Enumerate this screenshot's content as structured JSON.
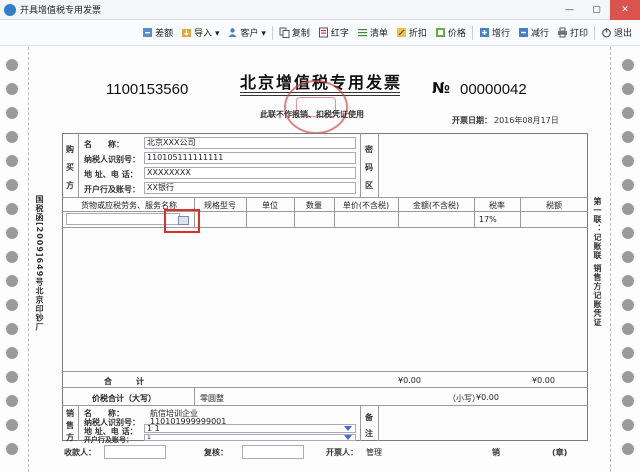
{
  "window": {
    "title": "开具增值税专用发票",
    "minimize": "—",
    "maximize": "▢",
    "close": "✕"
  },
  "toolbar": {
    "items": [
      {
        "label": "差额",
        "icon": "difference-icon"
      },
      {
        "label": "导入 ▾",
        "icon": "import-icon"
      },
      {
        "label": "客户 ▾",
        "icon": "customer-icon"
      },
      {
        "label": "复制",
        "icon": "copy-icon"
      },
      {
        "label": "红字",
        "icon": "red-invoice-icon"
      },
      {
        "label": "清单",
        "icon": "list-icon"
      },
      {
        "label": "折扣",
        "icon": "discount-icon"
      },
      {
        "label": "价格",
        "icon": "price-icon"
      },
      {
        "label": "增行",
        "icon": "add-row-icon"
      },
      {
        "label": "减行",
        "icon": "remove-row-icon"
      },
      {
        "label": "打印",
        "icon": "print-icon"
      },
      {
        "label": "退出",
        "icon": "exit-icon"
      }
    ]
  },
  "invoice": {
    "title": "北京增值税专用发票",
    "code": "1100153560",
    "number_symbol": "№",
    "number": "00000042",
    "subtitle": "此联不作报销、扣税凭证使用",
    "date_label": "开票日期：",
    "date": "2016年08月17日",
    "left_side_text": "国税函[2009]649号北京印钞厂",
    "right_side_text": "第一联：记账联 销售方记账凭证",
    "buyer": {
      "section_label": [
        "购",
        "买",
        "方"
      ],
      "name_label": "名　　称：",
      "name": "北京XXX公司",
      "tax_id_label": "纳税人识别号：",
      "tax_id": "110105111111111",
      "address_label": "地 址、电 话：",
      "address": "XXXXXXXX",
      "bank_label": "开户行及账号：",
      "bank": "XX银行"
    },
    "password_area_label": [
      "密",
      "码",
      "区"
    ],
    "columns": [
      "货物或应税劳务、服务名称",
      "规格型号",
      "单位",
      "数量",
      "单价(不含税)",
      "金额(不含税)",
      "税率",
      "税额"
    ],
    "row1": {
      "tax_rate": "17%"
    },
    "total_label": "合　　　计",
    "total_amount": "¥0.00",
    "total_tax": "¥0.00",
    "tax_total_label": "价税合计（大写）",
    "tax_total_upper": "零圆整",
    "tax_total_small_label": "（小写）",
    "tax_total_small": "¥0.00",
    "seller": {
      "section_label": [
        "销",
        "售",
        "方"
      ],
      "name_label": "名　　称：",
      "name": "航信培训企业",
      "tax_id_label": "纳税人识别号：",
      "tax_id": "110101999999001",
      "address_label": "地 址、电 话：",
      "address": "1 1",
      "bank_label": "开户行及账号：",
      "bank": "1"
    },
    "remarks_label": [
      "备",
      "注"
    ],
    "payee_label": "收款人：",
    "reviewer_label": "复核：",
    "issuer_label": "开票人：",
    "issuer": "管理",
    "seller_stamp_label": "销",
    "stamp_suffix": "(章)"
  }
}
